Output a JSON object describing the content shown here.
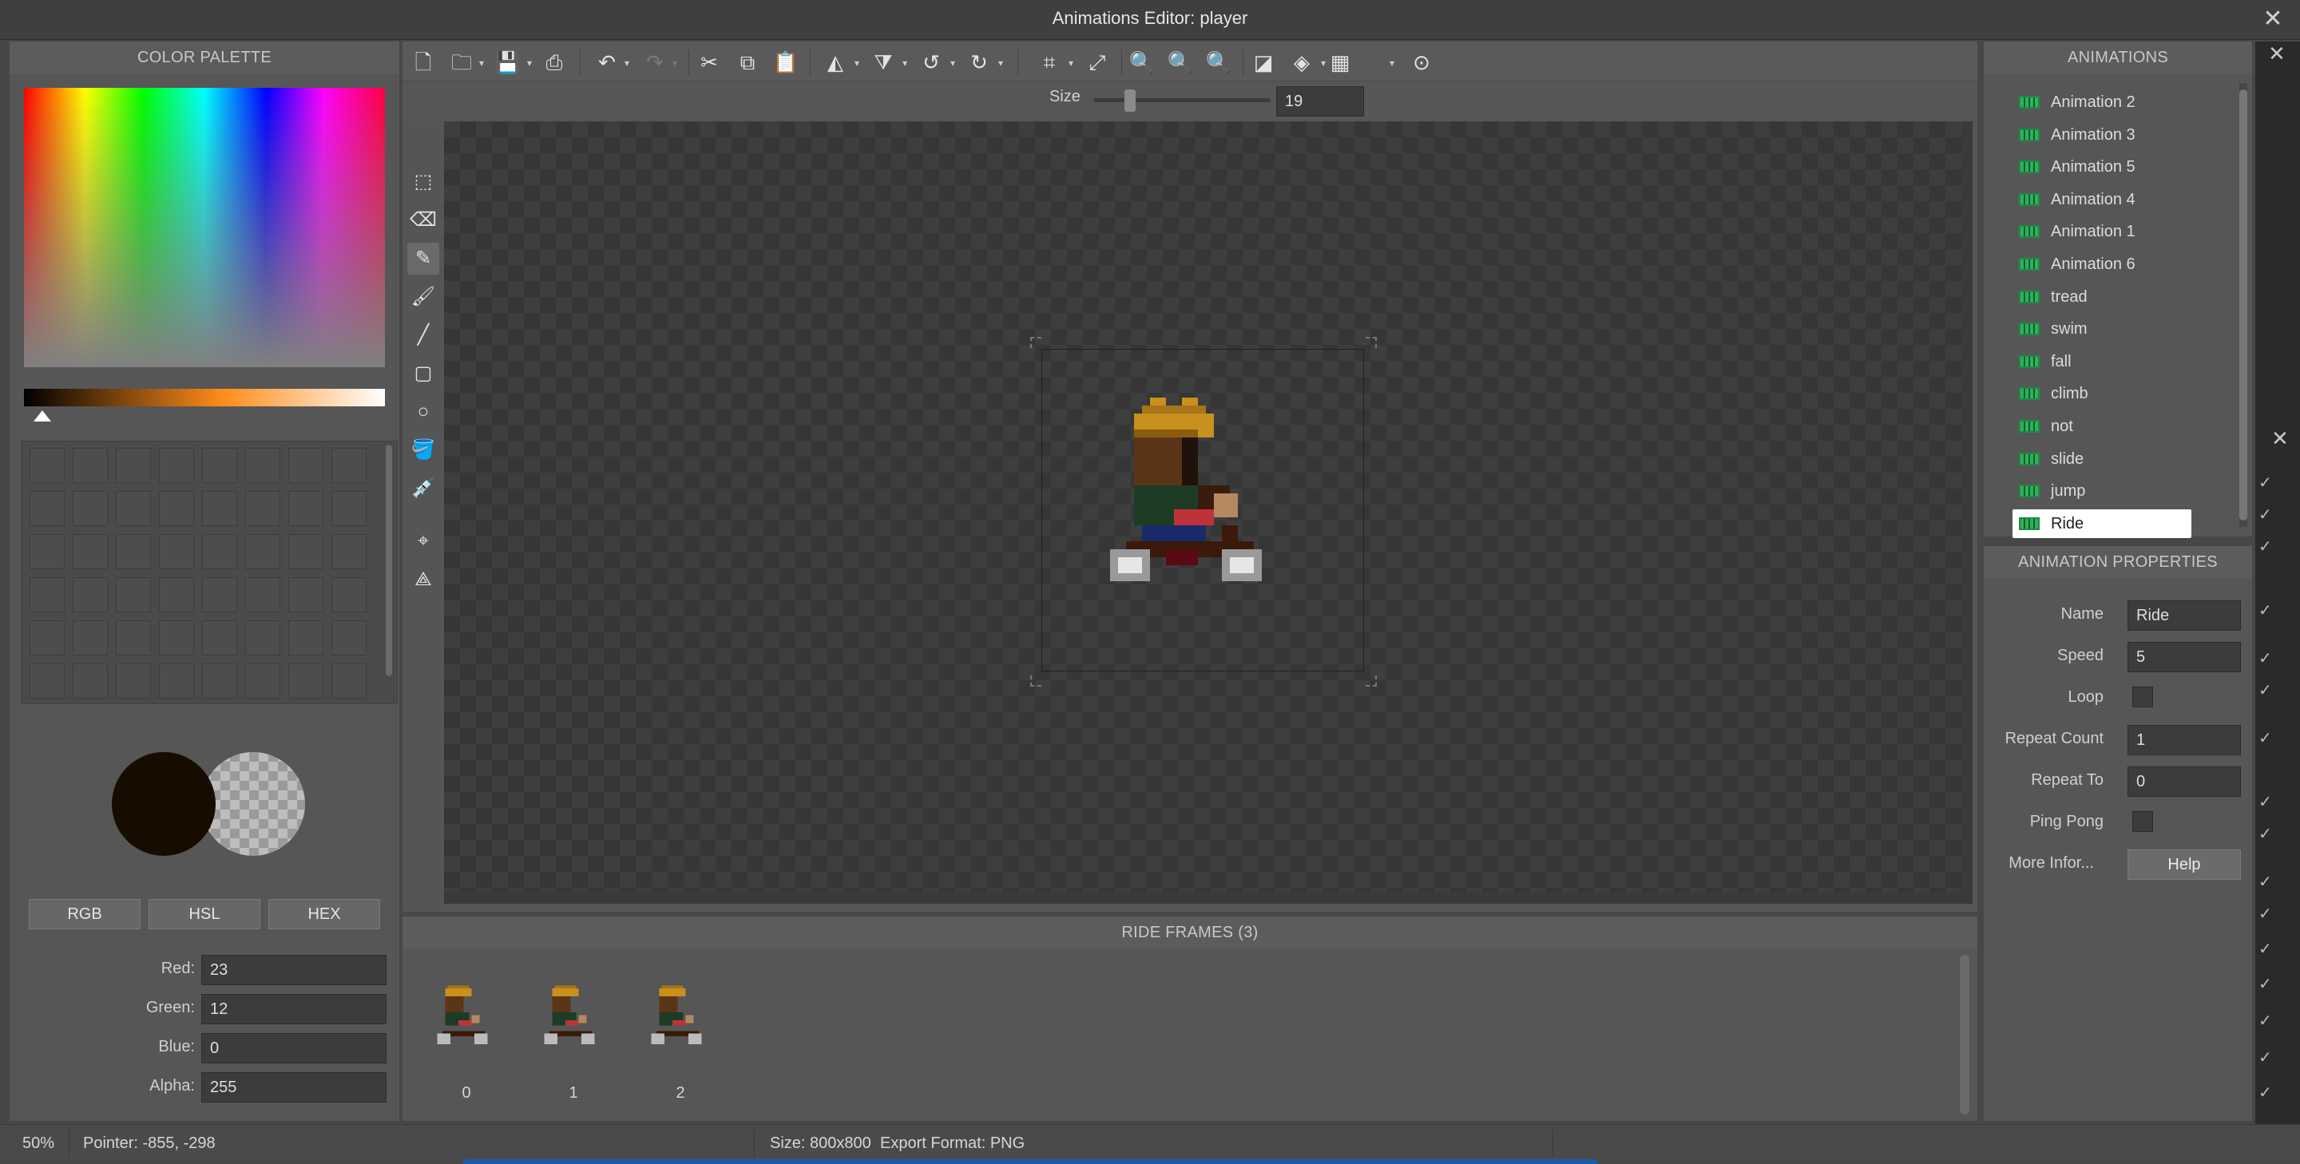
{
  "window": {
    "title": "Animations Editor: player",
    "close_glyph": "✕"
  },
  "palette": {
    "header": "COLOR PALETTE",
    "primary_color": "#170c00",
    "modes": [
      "RGB",
      "HSL",
      "HEX"
    ],
    "fields": [
      {
        "label": "Red:",
        "value": "23"
      },
      {
        "label": "Green:",
        "value": "12"
      },
      {
        "label": "Blue:",
        "value": "0"
      },
      {
        "label": "Alpha:",
        "value": "255"
      }
    ]
  },
  "toolbar": {
    "icons": [
      "new-file-icon",
      "open-folder-icon",
      "save-icon",
      "export-icon",
      "undo-icon",
      "redo-icon",
      "cut-icon",
      "copy-icon",
      "paste-icon",
      "flip-horizontal-icon",
      "flip-vertical-icon",
      "rotate-left-icon",
      "rotate-right-icon",
      "crop-icon",
      "resize-icon",
      "zoom-in-icon",
      "zoom-out-icon",
      "zoom-fit-icon",
      "invert-icon",
      "layers-icon",
      "grid-icon",
      "play-icon"
    ],
    "size_label": "Size",
    "size_value": "19"
  },
  "tools": [
    "select-tool-icon",
    "eraser-tool-icon",
    "pencil-tool-icon",
    "brush-tool-icon",
    "line-tool-icon",
    "rectangle-tool-icon",
    "ellipse-tool-icon",
    "fill-tool-icon",
    "eyedropper-tool-icon",
    "origin-tool-icon",
    "bone-tool-icon"
  ],
  "frames": {
    "header": "RIDE FRAMES (3)",
    "items": [
      {
        "label": "0"
      },
      {
        "label": "1"
      },
      {
        "label": "2"
      }
    ]
  },
  "animations": {
    "header": "ANIMATIONS",
    "items": [
      {
        "label": "Animation 2"
      },
      {
        "label": "Animation 3"
      },
      {
        "label": "Animation 5"
      },
      {
        "label": "Animation 4"
      },
      {
        "label": "Animation 1"
      },
      {
        "label": "Animation 6"
      },
      {
        "label": "tread"
      },
      {
        "label": "swim"
      },
      {
        "label": "fall"
      },
      {
        "label": "climb"
      },
      {
        "label": "not"
      },
      {
        "label": "slide"
      },
      {
        "label": "jump"
      },
      {
        "label": "Ride"
      }
    ],
    "selected": "Ride"
  },
  "properties": {
    "header": "ANIMATION PROPERTIES",
    "name_label": "Name",
    "name_value": "Ride",
    "speed_label": "Speed",
    "speed_value": "5",
    "loop_label": "Loop",
    "loop_checked": false,
    "repeat_count_label": "Repeat Count",
    "repeat_count_value": "1",
    "repeat_to_label": "Repeat To",
    "repeat_to_value": "0",
    "pingpong_label": "Ping Pong",
    "pingpong_checked": false,
    "more_info_label": "More Infor...",
    "help_label": "Help"
  },
  "status": {
    "zoom": "50%",
    "pointer": "Pointer: -855, -298",
    "size": "Size: 800x800",
    "export_format": "Export Format: PNG"
  },
  "background_window": {
    "close_glyph": "✕"
  }
}
